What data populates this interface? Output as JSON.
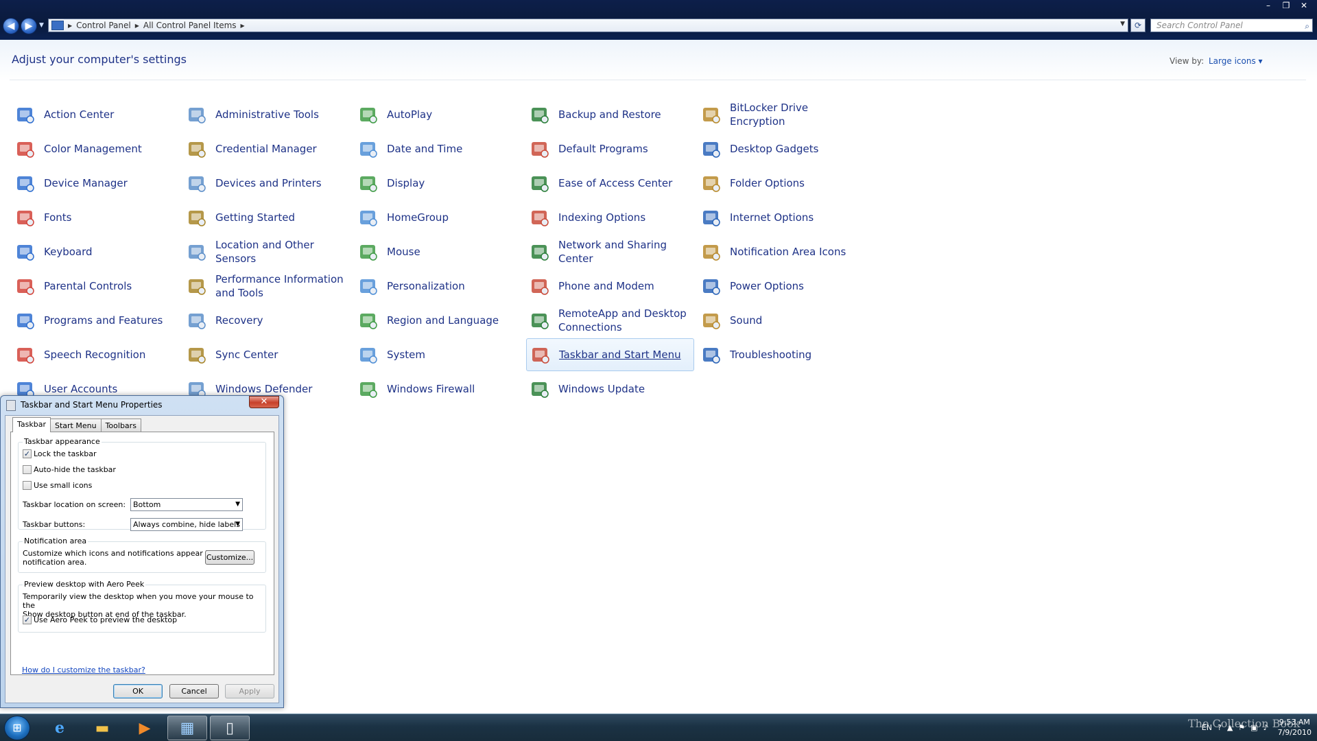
{
  "window": {
    "minimize": "–",
    "maximize": "❐",
    "close": "✕"
  },
  "address": {
    "crumbs": [
      "Control Panel",
      "All Control Panel Items"
    ],
    "search_placeholder": "Search Control Panel"
  },
  "header": {
    "title": "Adjust your computer's settings",
    "view_by_label": "View by:",
    "view_by_value": "Large icons ▾"
  },
  "items": [
    {
      "label": "Action Center",
      "icon": "flag-icon"
    },
    {
      "label": "Administrative Tools",
      "icon": "tools-icon"
    },
    {
      "label": "AutoPlay",
      "icon": "autoplay-icon"
    },
    {
      "label": "Backup and Restore",
      "icon": "backup-icon"
    },
    {
      "label": "BitLocker Drive Encryption",
      "icon": "key-icon"
    },
    {
      "label": "Color Management",
      "icon": "color-icon"
    },
    {
      "label": "Credential Manager",
      "icon": "vault-icon"
    },
    {
      "label": "Date and Time",
      "icon": "clock-icon"
    },
    {
      "label": "Default Programs",
      "icon": "default-icon"
    },
    {
      "label": "Desktop Gadgets",
      "icon": "gadget-icon"
    },
    {
      "label": "Device Manager",
      "icon": "device-icon"
    },
    {
      "label": "Devices and Printers",
      "icon": "printer-icon"
    },
    {
      "label": "Display",
      "icon": "monitor-icon"
    },
    {
      "label": "Ease of Access Center",
      "icon": "accessibility-icon"
    },
    {
      "label": "Folder Options",
      "icon": "folder-icon"
    },
    {
      "label": "Fonts",
      "icon": "font-icon"
    },
    {
      "label": "Getting Started",
      "icon": "start-icon"
    },
    {
      "label": "HomeGroup",
      "icon": "homegroup-icon"
    },
    {
      "label": "Indexing Options",
      "icon": "index-icon"
    },
    {
      "label": "Internet Options",
      "icon": "globe-icon"
    },
    {
      "label": "Keyboard",
      "icon": "keyboard-icon"
    },
    {
      "label": "Location and Other Sensors",
      "icon": "sensor-icon"
    },
    {
      "label": "Mouse",
      "icon": "mouse-icon"
    },
    {
      "label": "Network and Sharing Center",
      "icon": "network-icon"
    },
    {
      "label": "Notification Area Icons",
      "icon": "tray-icon"
    },
    {
      "label": "Parental Controls",
      "icon": "parental-icon"
    },
    {
      "label": "Performance Information and Tools",
      "icon": "performance-icon"
    },
    {
      "label": "Personalization",
      "icon": "personalize-icon"
    },
    {
      "label": "Phone and Modem",
      "icon": "phone-icon"
    },
    {
      "label": "Power Options",
      "icon": "power-icon"
    },
    {
      "label": "Programs and Features",
      "icon": "programs-icon"
    },
    {
      "label": "Recovery",
      "icon": "recovery-icon"
    },
    {
      "label": "Region and Language",
      "icon": "region-icon"
    },
    {
      "label": "RemoteApp and Desktop Connections",
      "icon": "remote-icon"
    },
    {
      "label": "Sound",
      "icon": "speaker-icon"
    },
    {
      "label": "Speech Recognition",
      "icon": "microphone-icon"
    },
    {
      "label": "Sync Center",
      "icon": "sync-icon"
    },
    {
      "label": "System",
      "icon": "system-icon"
    },
    {
      "label": "Taskbar and Start Menu",
      "icon": "taskbar-icon"
    },
    {
      "label": "Troubleshooting",
      "icon": "troubleshoot-icon"
    },
    {
      "label": "User Accounts",
      "icon": "users-icon"
    },
    {
      "label": "Windows Defender",
      "icon": "defender-icon"
    },
    {
      "label": "Windows Firewall",
      "icon": "firewall-icon"
    },
    {
      "label": "Windows Update",
      "icon": "update-icon"
    }
  ],
  "dialog": {
    "title": "Taskbar and Start Menu Properties",
    "close": "✕",
    "tabs": [
      "Taskbar",
      "Start Menu",
      "Toolbars"
    ],
    "appearance": {
      "title": "Taskbar appearance",
      "lock": "Lock the taskbar",
      "autohide": "Auto-hide the taskbar",
      "small_icons": "Use small icons",
      "location_label": "Taskbar location on screen:",
      "location_value": "Bottom",
      "buttons_label": "Taskbar buttons:",
      "buttons_value": "Always combine, hide labels"
    },
    "checkmark": "✓",
    "notification": {
      "title": "Notification area",
      "text_1": "Customize which icons and notifications appear in the",
      "text_2": "notification area.",
      "customize": "Customize..."
    },
    "peek": {
      "title": "Preview desktop with Aero Peek",
      "text_1": "Temporarily view the desktop when you move your mouse to the",
      "text_2": "Show desktop button at end of the taskbar.",
      "checkbox": "Use Aero Peek to preview the desktop"
    },
    "help_link": "How do I customize the taskbar?",
    "ok": "OK",
    "cancel": "Cancel",
    "apply": "Apply"
  },
  "taskbar": {
    "lang": "EN",
    "time": "9:53 AM",
    "date": "7/9/2010"
  },
  "watermark": "The Collection Book"
}
